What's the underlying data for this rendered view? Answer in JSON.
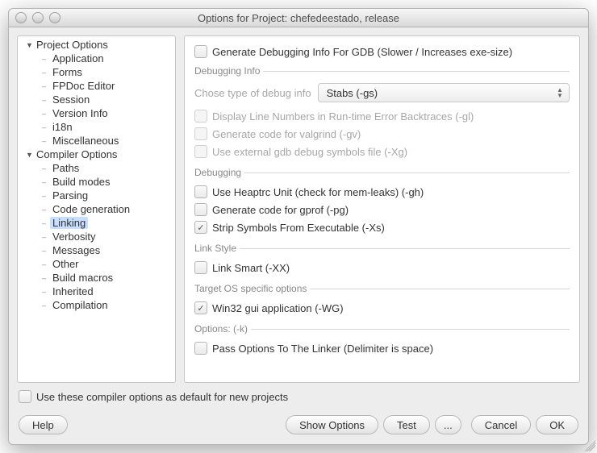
{
  "window_title": "Options for Project: chefedeestado, release",
  "sidebar": {
    "groups": [
      {
        "label": "Project Options",
        "items": [
          {
            "label": "Application",
            "selected": false
          },
          {
            "label": "Forms",
            "selected": false
          },
          {
            "label": "FPDoc Editor",
            "selected": false
          },
          {
            "label": "Session",
            "selected": false
          },
          {
            "label": "Version Info",
            "selected": false
          },
          {
            "label": "i18n",
            "selected": false
          },
          {
            "label": "Miscellaneous",
            "selected": false
          }
        ]
      },
      {
        "label": "Compiler Options",
        "items": [
          {
            "label": "Paths",
            "selected": false
          },
          {
            "label": "Build modes",
            "selected": false
          },
          {
            "label": "Parsing",
            "selected": false
          },
          {
            "label": "Code generation",
            "selected": false
          },
          {
            "label": "Linking",
            "selected": true
          },
          {
            "label": "Verbosity",
            "selected": false
          },
          {
            "label": "Messages",
            "selected": false
          },
          {
            "label": "Other",
            "selected": false
          },
          {
            "label": "Build macros",
            "selected": false
          },
          {
            "label": "Inherited",
            "selected": false
          },
          {
            "label": "Compilation",
            "selected": false
          }
        ]
      }
    ]
  },
  "content": {
    "top_checkbox": {
      "label": "Generate Debugging Info For GDB (Slower / Increases exe-size)",
      "checked": false,
      "disabled": false
    },
    "debugging_info": {
      "legend": "Debugging Info",
      "combo_label": "Chose type of debug info",
      "combo_value": "Stabs (-gs)",
      "items": [
        {
          "label": "Display Line Numbers in Run-time Error Backtraces (-gl)",
          "checked": false,
          "disabled": true
        },
        {
          "label": "Generate code for valgrind (-gv)",
          "checked": false,
          "disabled": true
        },
        {
          "label": "Use external gdb debug symbols file (-Xg)",
          "checked": false,
          "disabled": true
        }
      ]
    },
    "debugging": {
      "legend": "Debugging",
      "items": [
        {
          "label": "Use Heaptrc Unit (check for mem-leaks) (-gh)",
          "checked": false
        },
        {
          "label": "Generate code for gprof (-pg)",
          "checked": false
        },
        {
          "label": "Strip Symbols From Executable (-Xs)",
          "checked": true
        }
      ]
    },
    "link_style": {
      "legend": "Link Style",
      "items": [
        {
          "label": "Link Smart (-XX)",
          "checked": false
        }
      ]
    },
    "target_os": {
      "legend": "Target OS specific options",
      "items": [
        {
          "label": "Win32 gui application (-WG)",
          "checked": true
        }
      ]
    },
    "options_k": {
      "legend": "Options:  (-k)",
      "items": [
        {
          "label": "Pass Options To The Linker (Delimiter is space)",
          "checked": false
        }
      ]
    }
  },
  "footer_checkbox": {
    "label": "Use these compiler options as default for new projects",
    "checked": false
  },
  "buttons": {
    "help": "Help",
    "show_options": "Show Options",
    "test": "Test",
    "more": "...",
    "cancel": "Cancel",
    "ok": "OK"
  }
}
